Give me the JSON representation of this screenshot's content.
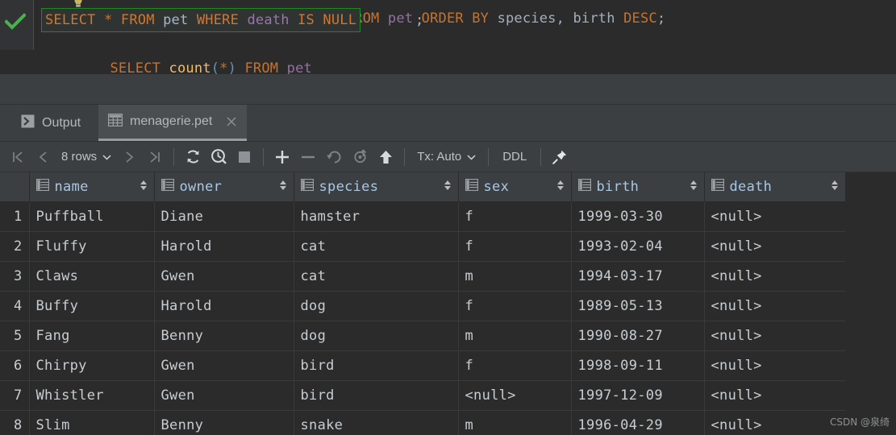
{
  "editor": {
    "status_icon": "green-check-icon",
    "intention_icon": "lightbulb-icon",
    "line_above": "SELECT name, species, birth FROM pet ORDER BY species, birth DESC;",
    "line_current": "SELECT * FROM pet WHERE death IS NULL",
    "line_current_terminator": ";",
    "line_below": "SELECT count(*) FROM pet",
    "tokens": {
      "select": "SELECT",
      "star": "*",
      "from": "FROM",
      "table": "pet",
      "where": "WHERE",
      "column": "death",
      "is": "IS",
      "nul": "NULL"
    },
    "colors": {
      "keyword": "#cc7832",
      "identifier": "#9876aa",
      "plain": "#a9b7c6",
      "highlight_border": "#1f8a1f",
      "background": "#2b2b2b"
    }
  },
  "tabs": [
    {
      "label": "Output",
      "icon": "console-output-icon",
      "active": false,
      "closable": false
    },
    {
      "label": "menagerie.pet",
      "icon": "table-icon",
      "active": true,
      "closable": true
    }
  ],
  "toolbar": {
    "first_page": "first-page-icon",
    "prev_page": "prev-page-icon",
    "rows_label": "8 rows",
    "rows_dropdown_icon": "chevron-down-icon",
    "next_page": "next-page-icon",
    "last_page": "last-page-icon",
    "reload": "refresh-icon",
    "page_size": "query-time-icon",
    "stop": "stop-icon",
    "add_row": "plus-icon",
    "delete_row": "minus-icon",
    "revert": "revert-icon",
    "revert_selected": "revert-selected-icon",
    "submit": "upload-arrow-icon",
    "tx_label": "Tx: Auto",
    "tx_dropdown_icon": "chevron-down-icon",
    "ddl_label": "DDL",
    "pin": "pin-icon"
  },
  "grid": {
    "column_icon": "table-column-icon",
    "sort_icon": "sort-arrows-icon",
    "columns": [
      {
        "name": "name"
      },
      {
        "name": "owner"
      },
      {
        "name": "species"
      },
      {
        "name": "sex"
      },
      {
        "name": "birth"
      },
      {
        "name": "death"
      }
    ],
    "null_text": "<null>",
    "rows": [
      {
        "n": "1",
        "name": "Puffball",
        "owner": "Diane",
        "species": "hamster",
        "sex": "f",
        "birth": "1999-03-30",
        "death": "<null>"
      },
      {
        "n": "2",
        "name": "Fluffy",
        "owner": "Harold",
        "species": "cat",
        "sex": "f",
        "birth": "1993-02-04",
        "death": "<null>"
      },
      {
        "n": "3",
        "name": "Claws",
        "owner": "Gwen",
        "species": "cat",
        "sex": "m",
        "birth": "1994-03-17",
        "death": "<null>"
      },
      {
        "n": "4",
        "name": "Buffy",
        "owner": "Harold",
        "species": "dog",
        "sex": "f",
        "birth": "1989-05-13",
        "death": "<null>"
      },
      {
        "n": "5",
        "name": "Fang",
        "owner": "Benny",
        "species": "dog",
        "sex": "m",
        "birth": "1990-08-27",
        "death": "<null>"
      },
      {
        "n": "6",
        "name": "Chirpy",
        "owner": "Gwen",
        "species": "bird",
        "sex": "f",
        "birth": "1998-09-11",
        "death": "<null>"
      },
      {
        "n": "7",
        "name": "Whistler",
        "owner": "Gwen",
        "species": "bird",
        "sex": "<null>",
        "birth": "1997-12-09",
        "death": "<null>"
      },
      {
        "n": "8",
        "name": "Slim",
        "owner": "Benny",
        "species": "snake",
        "sex": "m",
        "birth": "1996-04-29",
        "death": "<null>"
      }
    ]
  },
  "watermark": "CSDN @泉绮"
}
